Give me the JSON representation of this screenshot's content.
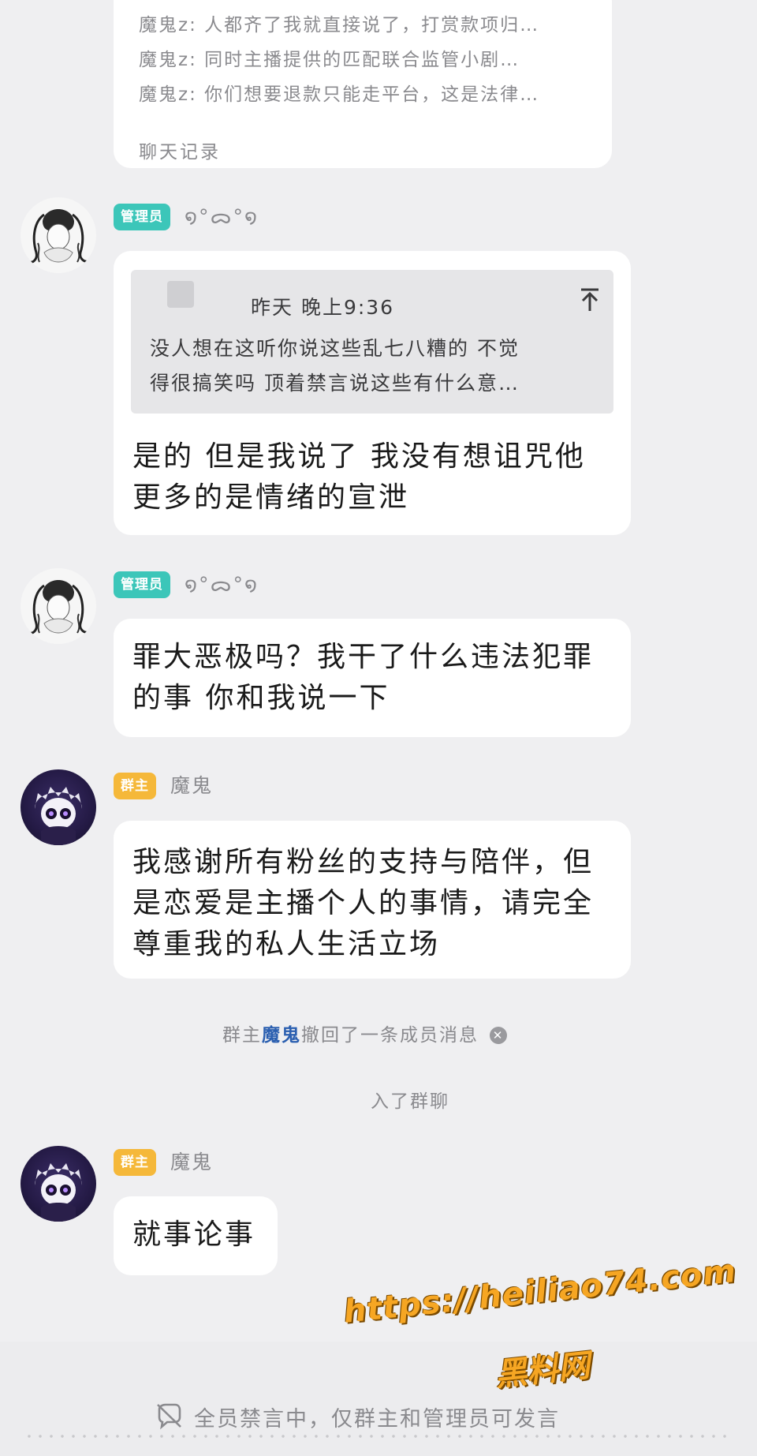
{
  "chat_record": {
    "lines": [
      "魔鬼z: 人都齐了我就直接说了，打赏款项归…",
      "魔鬼z: 同时主播提供的匹配联合监管小剧…",
      "魔鬼z: 你们想要退款只能走平台，这是法律…"
    ],
    "footer": "聊天记录"
  },
  "messages": [
    {
      "role": "管理员",
      "nickname": "໑°ᯅ°໑",
      "quote": {
        "time": "昨天 晚上9:36",
        "text": [
          "没人想在这听你说这些乱七八糟的 不觉",
          "得很搞笑吗 顶着禁言说这些有什么意…"
        ]
      },
      "text": [
        "是的 但是我说了 我没有想诅咒他",
        "更多的是情绪的宣泄"
      ]
    },
    {
      "role": "管理员",
      "nickname": "໑°ᯅ°໑",
      "text": [
        "罪大恶极吗？我干了什么违法犯罪",
        "的事 你和我说一下"
      ]
    },
    {
      "role": "群主",
      "nickname": "魔鬼",
      "text": [
        "我感谢所有粉丝的支持与陪伴，但",
        "是恋爱是主播个人的事情，请完全",
        "尊重我的私人生活立场"
      ]
    },
    {
      "role": "群主",
      "nickname": "魔鬼",
      "text": [
        "就事论事"
      ]
    }
  ],
  "notices": {
    "recall_prefix": "群主",
    "recall_name": "魔鬼",
    "recall_suffix": "撤回了一条成员消息",
    "joined": "入了群聊"
  },
  "bottom": {
    "muted": "全员禁言中，仅群主和管理员可发言",
    "watermark_url": "https://heiliao74.com",
    "watermark_name": "黑料网"
  },
  "colors": {
    "background": "#efeff1",
    "admin_badge": "#3cc6b9",
    "owner_badge": "#f5b83a",
    "highlight_name": "#2b5fb0",
    "watermark": "#f6a623"
  }
}
